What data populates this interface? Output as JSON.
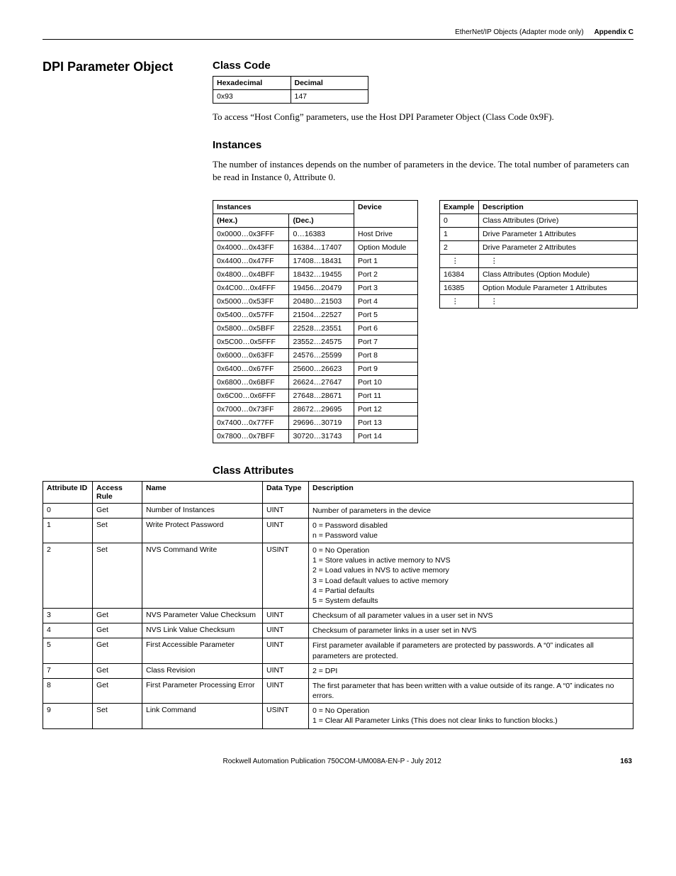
{
  "header": {
    "chapter": "EtherNet/IP Objects (Adapter mode only)",
    "appendix": "Appendix C"
  },
  "title": "DPI Parameter Object",
  "classCode": {
    "heading": "Class Code",
    "cols": [
      "Hexadecimal",
      "Decimal"
    ],
    "row": [
      "0x93",
      "147"
    ],
    "note": "To access “Host Config” parameters, use the Host DPI Parameter Object (Class Code 0x9F)."
  },
  "instances": {
    "heading": "Instances",
    "intro": "The number of instances depends on the number of parameters in the device. The total number of parameters can be read in Instance 0, Attribute 0.",
    "tableHeaders": {
      "instances": "Instances",
      "hex": "(Hex.)",
      "dec": "(Dec.)",
      "device": "Device"
    },
    "rows": [
      {
        "hex": "0x0000…0x3FFF",
        "dec": "0…16383",
        "dev": "Host Drive"
      },
      {
        "hex": "0x4000…0x43FF",
        "dec": "16384…17407",
        "dev": "Option Module"
      },
      {
        "hex": "0x4400…0x47FF",
        "dec": "17408…18431",
        "dev": "Port 1"
      },
      {
        "hex": "0x4800…0x4BFF",
        "dec": "18432…19455",
        "dev": "Port 2"
      },
      {
        "hex": "0x4C00…0x4FFF",
        "dec": "19456…20479",
        "dev": "Port 3"
      },
      {
        "hex": "0x5000…0x53FF",
        "dec": "20480…21503",
        "dev": "Port 4"
      },
      {
        "hex": "0x5400…0x57FF",
        "dec": "21504…22527",
        "dev": "Port 5"
      },
      {
        "hex": "0x5800…0x5BFF",
        "dec": "22528…23551",
        "dev": "Port 6"
      },
      {
        "hex": "0x5C00…0x5FFF",
        "dec": "23552…24575",
        "dev": "Port 7"
      },
      {
        "hex": "0x6000…0x63FF",
        "dec": "24576…25599",
        "dev": "Port 8"
      },
      {
        "hex": "0x6400…0x67FF",
        "dec": "25600…26623",
        "dev": "Port 9"
      },
      {
        "hex": "0x6800…0x6BFF",
        "dec": "26624…27647",
        "dev": "Port 10"
      },
      {
        "hex": "0x6C00…0x6FFF",
        "dec": "27648…28671",
        "dev": "Port 11"
      },
      {
        "hex": "0x7000…0x73FF",
        "dec": "28672…29695",
        "dev": "Port 12"
      },
      {
        "hex": "0x7400…0x77FF",
        "dec": "29696…30719",
        "dev": "Port 13"
      },
      {
        "hex": "0x7800…0x7BFF",
        "dec": "30720…31743",
        "dev": "Port 14"
      }
    ],
    "exampleHeaders": {
      "ex": "Example",
      "desc": "Description"
    },
    "exampleRows": [
      {
        "ex": "0",
        "desc": "Class Attributes (Drive)"
      },
      {
        "ex": "1",
        "desc": "Drive Parameter 1 Attributes"
      },
      {
        "ex": "2",
        "desc": "Drive Parameter 2 Attributes"
      },
      {
        "ex": "⋮",
        "desc": "⋮"
      },
      {
        "ex": "16384",
        "desc": "Class Attributes (Option Module)"
      },
      {
        "ex": "16385",
        "desc": "Option Module Parameter 1 Attributes"
      },
      {
        "ex": "⋮",
        "desc": "⋮"
      }
    ]
  },
  "classAttr": {
    "heading": "Class Attributes",
    "cols": [
      "Attribute ID",
      "Access Rule",
      "Name",
      "Data Type",
      "Description"
    ],
    "rows": [
      {
        "id": "0",
        "rule": "Get",
        "name": "Number of Instances",
        "dt": "UINT",
        "desc": [
          "Number of parameters in the device"
        ]
      },
      {
        "id": "1",
        "rule": "Set",
        "name": "Write Protect Password",
        "dt": "UINT",
        "desc": [
          "0 = Password disabled",
          "n = Password value"
        ]
      },
      {
        "id": "2",
        "rule": "Set",
        "name": "NVS Command Write",
        "dt": "USINT",
        "desc": [
          "0 = No Operation",
          "1 = Store values in active memory to NVS",
          "2 = Load values in NVS to active memory",
          "3 = Load default values to active memory",
          "4 = Partial defaults",
          "5 = System defaults"
        ]
      },
      {
        "id": "3",
        "rule": "Get",
        "name": "NVS Parameter Value Checksum",
        "dt": "UINT",
        "desc": [
          "Checksum of all parameter values in a user set in NVS"
        ]
      },
      {
        "id": "4",
        "rule": "Get",
        "name": "NVS Link Value Checksum",
        "dt": "UINT",
        "desc": [
          "Checksum of parameter links in a user set in NVS"
        ]
      },
      {
        "id": "5",
        "rule": "Get",
        "name": "First Accessible Parameter",
        "dt": "UINT",
        "desc": [
          "First parameter available if parameters are protected by passwords. A “0” indicates all parameters are protected."
        ]
      },
      {
        "id": "7",
        "rule": "Get",
        "name": "Class Revision",
        "dt": "UINT",
        "desc": [
          "2 = DPI"
        ]
      },
      {
        "id": "8",
        "rule": "Get",
        "name": "First Parameter Processing Error",
        "dt": "UINT",
        "desc": [
          "The first parameter that has been written with a value outside of its range. A “0” indicates no errors."
        ]
      },
      {
        "id": "9",
        "rule": "Set",
        "name": "Link Command",
        "dt": "USINT",
        "desc": [
          "0 = No Operation",
          "1 = Clear All Parameter Links (This does not clear links to function blocks.)"
        ]
      }
    ]
  },
  "footer": {
    "pub": "Rockwell Automation Publication 750COM-UM008A-EN-P - July 2012",
    "page": "163"
  }
}
